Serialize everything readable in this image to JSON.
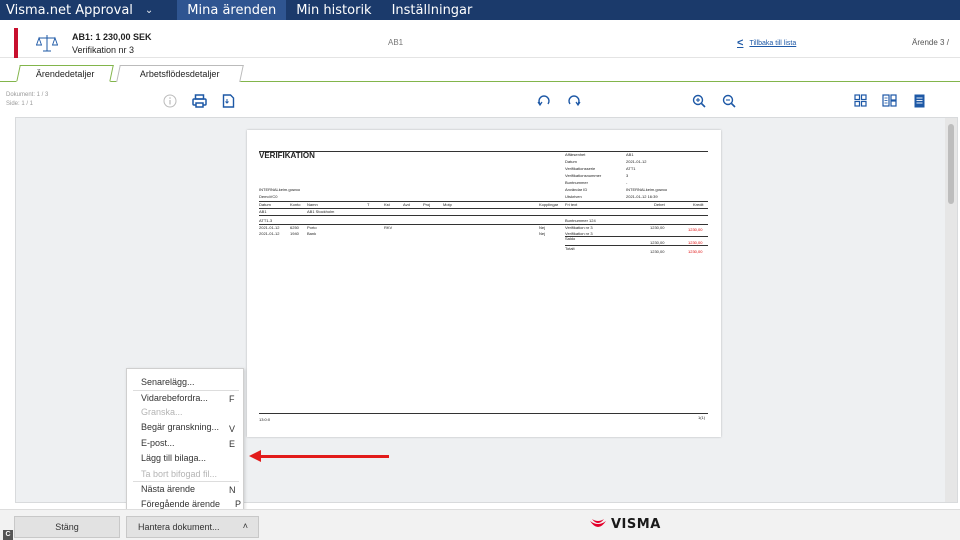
{
  "topbar": {
    "brand": "Visma.net Approval",
    "nav": [
      "Mina ärenden",
      "Min historik",
      "Inställningar"
    ],
    "active_index": 0
  },
  "header": {
    "title": "AB1: 1 230,00 SEK",
    "subtitle": "Verifikation nr 3",
    "center": "AB1",
    "back_link": "Tillbaka till lista",
    "case_counter": "Ärende 3 /"
  },
  "tabs": [
    "Ärendedetaljer",
    "Arbetsflödesdetaljer"
  ],
  "toolbar": {
    "doc_line": "Dokument: 1 / 3",
    "side_line": "Side: 1 / 1"
  },
  "document": {
    "title": "VERIFIKATION",
    "meta_labels": [
      "Affärsenhet",
      "Datum",
      "Verifikationsserie",
      "Verifikationsnummer",
      "Buntnummer",
      "Användar ID",
      "Utskriven"
    ],
    "meta_values": [
      "AB1",
      "2021-01-12",
      "ATT1",
      "3",
      "-",
      "INTERNALkeim.gowoo",
      "2021-01-12 16:39"
    ],
    "left_lines": [
      "INTERNALkeim.gowoo",
      "DemoVC0"
    ],
    "col_headers": [
      "Datum",
      "Konto",
      "Namn",
      "T",
      "Kst",
      "Avd",
      "Proj",
      "Motp",
      "Kopplingar",
      "Fri text",
      "Debet",
      "Kredit"
    ],
    "row_ab1": [
      "AB1",
      "AB1 Stockholm"
    ],
    "row_att": [
      "ATT1-3",
      "Buntnummer 124"
    ],
    "rows": [
      {
        "datum": "2021-01-12",
        "konto": "6250",
        "namn": "Porto",
        "kst": "RKV",
        "kopp": "Nej",
        "fritext": "Verifikation nr 3",
        "debet": "1230,00",
        "kredit": ""
      },
      {
        "datum": "2021-01-12",
        "konto": "1940",
        "namn": "Bank",
        "kst": "",
        "kopp": "Nej",
        "fritext": "Verifikation nr 3",
        "debet": "",
        "kredit": "1230,00"
      }
    ],
    "saldo_label": "Saldo",
    "saldo_debet": "1230,00",
    "saldo_kredit": "1230,00",
    "totalt_label": "Totalt",
    "totalt_debet": "1230,00",
    "totalt_kredit": "1230,00",
    "footer_left": "13:0:0",
    "footer_right": "1(1)"
  },
  "menu": {
    "items": [
      {
        "label": "Senarelägg...",
        "shortcut": "",
        "disabled": false
      },
      {
        "label": "Vidarebefordra...",
        "shortcut": "F",
        "disabled": false
      },
      {
        "label": "Granska...",
        "shortcut": "",
        "disabled": true
      },
      {
        "label": "Begär granskning...",
        "shortcut": "V",
        "disabled": false
      },
      {
        "label": "E-post...",
        "shortcut": "E",
        "disabled": false
      },
      {
        "label": "Lägg till bilaga...",
        "shortcut": "",
        "disabled": false
      },
      {
        "label": "Ta bort bifogad fil...",
        "shortcut": "",
        "disabled": true
      },
      {
        "label": "Nästa ärende",
        "shortcut": "N",
        "disabled": false
      },
      {
        "label": "Föregående ärende",
        "shortcut": "P",
        "disabled": false
      }
    ]
  },
  "bottom": {
    "close_label": "Stäng",
    "manage_label": "Hantera dokument...",
    "logo": "VISMA"
  },
  "colors": {
    "topbar": "#1b3a6b",
    "accent_green": "#82b54b",
    "link_blue": "#1d58a6",
    "annotation_red": "#e21b1b",
    "visma_red": "#e4002b"
  }
}
